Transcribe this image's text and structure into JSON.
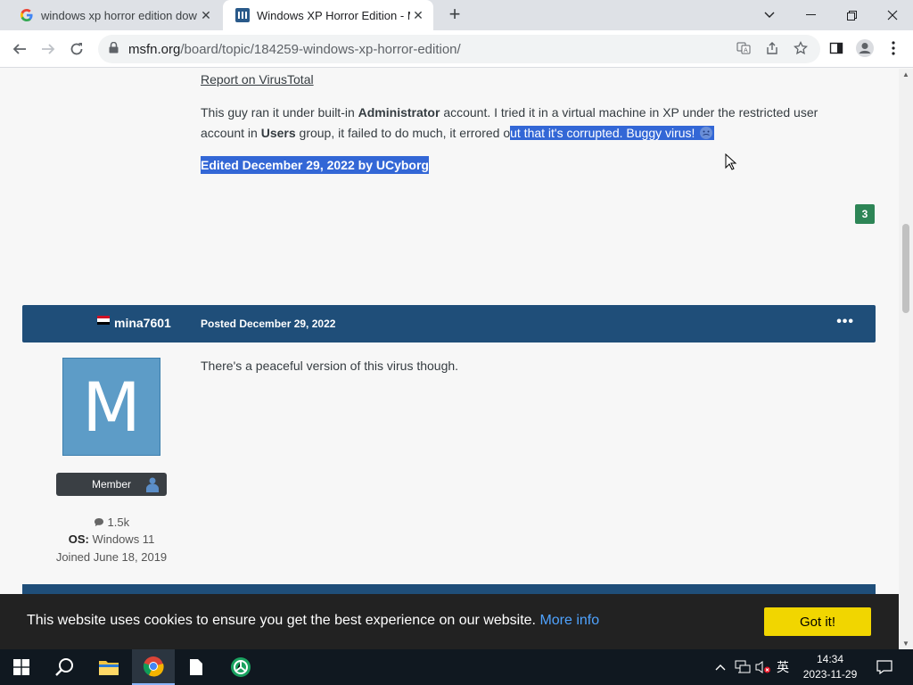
{
  "browser": {
    "tabs": [
      {
        "title": "windows xp horror edition dow",
        "active": false
      },
      {
        "title": "Windows XP Horror Edition - M",
        "active": true
      }
    ],
    "url_domain": "msfn.org",
    "url_path": "/board/topic/184259-windows-xp-horror-edition/"
  },
  "post1": {
    "report_link": "Report on VirusTotal",
    "p_part1": "This guy ran it under built-in ",
    "p_bold1": "Administrator",
    "p_part2": " account. I tried it in a virtual machine in XP under the restricted user account in ",
    "p_bold2": "Users",
    "p_part3": " group, it failed to do much, it errored o",
    "p_highlight": "ut that it's corrupted. Buggy virus!",
    "edited": "Edited December 29, 2022 by UCyborg",
    "reputation": "3"
  },
  "post2": {
    "author": "mina7601",
    "posted": "Posted December 29, 2022",
    "menu": "•••",
    "avatar_letter": "M",
    "rank": "Member",
    "post_count": "1.5k",
    "os_label": "OS:",
    "os_value": "Windows 11",
    "joined": "Joined June 18, 2019",
    "text": "There's a peaceful version of this virus though."
  },
  "cookie": {
    "message": "This website uses cookies to ensure you get the best experience on our website.",
    "more_info": "More info",
    "button": "Got it!"
  },
  "taskbar": {
    "time": "14:34",
    "date": "2023-11-29",
    "ime": "英"
  },
  "colors": {
    "header_bar": "#1f4e79",
    "selection": "#3367d6",
    "reputation": "#2d8556",
    "cookie_button": "#f1d600"
  }
}
